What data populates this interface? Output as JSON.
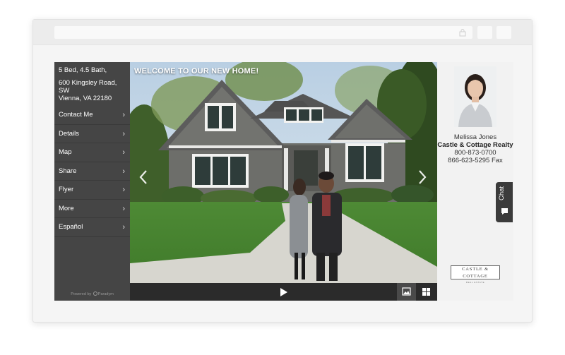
{
  "browser": {
    "url_icon": "lock-icon"
  },
  "listing": {
    "specs": "5 Bed, 4.5 Bath,",
    "address_line1": "600 Kingsley Road, SW",
    "address_line2": "Vienna, VA 22180"
  },
  "nav": {
    "items": [
      {
        "label": "Contact Me"
      },
      {
        "label": "Details"
      },
      {
        "label": "Map"
      },
      {
        "label": "Share"
      },
      {
        "label": "Flyer"
      },
      {
        "label": "More"
      },
      {
        "label": "Español"
      }
    ],
    "chevron": "›"
  },
  "powered_by": {
    "prefix": "Powered by",
    "brand": "Paradym"
  },
  "media": {
    "caption": "WELCOME TO OUR NEW HOME!",
    "icons": [
      "chevron-left-icon",
      "chevron-right-icon",
      "play-icon",
      "image-icon",
      "grid-icon"
    ]
  },
  "agent": {
    "name": "Melissa Jones",
    "company": "Castle & Cottage Realty",
    "phone": "800-873-0700",
    "fax": "866-623-5295 Fax"
  },
  "chat": {
    "label": "Chat"
  },
  "brand_logo": {
    "main": "CASTLE & COTTAGE",
    "sub": "REAL ESTATE"
  },
  "colors": {
    "sidebar": "#454545",
    "controls": "#2b2b2b",
    "chat_tab": "#3b3b3b",
    "page_bg": "#f2f2f2"
  }
}
